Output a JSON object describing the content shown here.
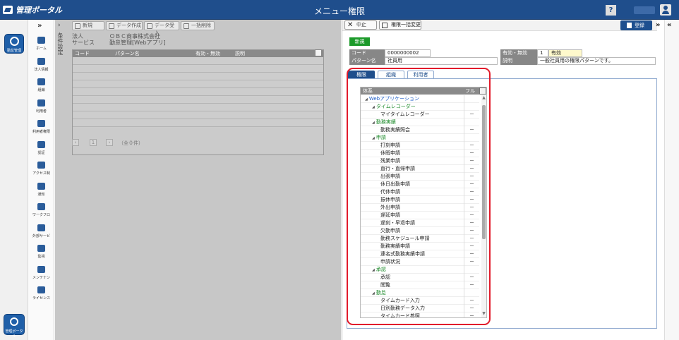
{
  "header": {
    "logo": "管理ポータル",
    "title": "メニュー権限",
    "help": "?"
  },
  "apps": {
    "top_label": "勤怠管理",
    "bottom_label": "管理ポータル"
  },
  "nav": {
    "items": [
      "ホーム",
      "法人情報",
      "組織",
      "利用者",
      "利用者権限",
      "認証",
      "アクセス制",
      "通知",
      "ワークフロ",
      "外部サービ",
      "監視",
      "メンテナン",
      "ライセンス"
    ]
  },
  "left": {
    "vertical_label": "条件設定",
    "toolbar": {
      "new": "新規",
      "data_create": "データ作成",
      "data_import": "データ受入",
      "bulk_delete": "一括削除"
    },
    "info": {
      "corp_label": "法人",
      "corp_value": "ＯＢＣ商事株式会社",
      "service_label": "サービス",
      "service_value": "勤怠管理[Webアプリ]"
    },
    "grid": {
      "headers": [
        "コード",
        "パターン名",
        "有効・無効",
        "説明"
      ]
    },
    "pager": {
      "page": "1",
      "count": "（全０件）"
    }
  },
  "right": {
    "toolbar": {
      "cancel": "中止",
      "bulk_change": "権限一括変更",
      "save": "登録"
    },
    "badge": "新規",
    "form": {
      "code_label": "コード",
      "code_value": "0000000002",
      "pattern_label": "パターン名",
      "pattern_value": "社員用",
      "valid_label": "有効・無効",
      "valid_num": "1",
      "valid_text": "有効",
      "desc_label": "説明",
      "desc_value": "一般社員用の権限パターンです。"
    },
    "tabs": [
      "権限",
      "組織",
      "利用者"
    ],
    "tree": {
      "headers": [
        "体系",
        "フル"
      ],
      "rows": [
        {
          "label": "Webアプリケーション",
          "level": 0,
          "color": "blue",
          "val": ""
        },
        {
          "label": "タイムレコーダー",
          "level": 1,
          "color": "green",
          "val": ""
        },
        {
          "label": "マイタイムレコーダー",
          "level": 2,
          "color": "black",
          "val": "－"
        },
        {
          "label": "勤務実績",
          "level": 1,
          "color": "green",
          "val": ""
        },
        {
          "label": "勤務実績照会",
          "level": 2,
          "color": "black",
          "val": "－"
        },
        {
          "label": "申請",
          "level": 1,
          "color": "green",
          "val": ""
        },
        {
          "label": "打刻申請",
          "level": 2,
          "color": "black",
          "val": "－"
        },
        {
          "label": "休暇申請",
          "level": 2,
          "color": "black",
          "val": "－"
        },
        {
          "label": "残業申請",
          "level": 2,
          "color": "black",
          "val": "－"
        },
        {
          "label": "直行・直帰申請",
          "level": 2,
          "color": "black",
          "val": "－"
        },
        {
          "label": "出張申請",
          "level": 2,
          "color": "black",
          "val": "－"
        },
        {
          "label": "休日出勤申請",
          "level": 2,
          "color": "black",
          "val": "－"
        },
        {
          "label": "代休申請",
          "level": 2,
          "color": "black",
          "val": "－"
        },
        {
          "label": "振休申請",
          "level": 2,
          "color": "black",
          "val": "－"
        },
        {
          "label": "外出申請",
          "level": 2,
          "color": "black",
          "val": "－"
        },
        {
          "label": "遅延申請",
          "level": 2,
          "color": "black",
          "val": "－"
        },
        {
          "label": "遅刻・早退申請",
          "level": 2,
          "color": "black",
          "val": "－"
        },
        {
          "label": "欠勤申請",
          "level": 2,
          "color": "black",
          "val": "－"
        },
        {
          "label": "勤務スケジュール申請",
          "level": 2,
          "color": "black",
          "val": "－"
        },
        {
          "label": "勤務実績申請",
          "level": 2,
          "color": "black",
          "val": "－"
        },
        {
          "label": "連名式勤務実績申請",
          "level": 2,
          "color": "black",
          "val": "－"
        },
        {
          "label": "申請状況",
          "level": 2,
          "color": "black",
          "val": "－"
        },
        {
          "label": "承認",
          "level": 1,
          "color": "green",
          "val": ""
        },
        {
          "label": "承認",
          "level": 2,
          "color": "black",
          "val": "－"
        },
        {
          "label": "閲覧",
          "level": 2,
          "color": "black",
          "val": "－"
        },
        {
          "label": "勤怠",
          "level": 1,
          "color": "green",
          "val": ""
        },
        {
          "label": "タイムカード入力",
          "level": 2,
          "color": "black",
          "val": "－"
        },
        {
          "label": "日別勤務データ入力",
          "level": 2,
          "color": "black",
          "val": "－"
        },
        {
          "label": "タイムカード参照",
          "level": 2,
          "color": "black",
          "val": "－"
        }
      ]
    }
  }
}
